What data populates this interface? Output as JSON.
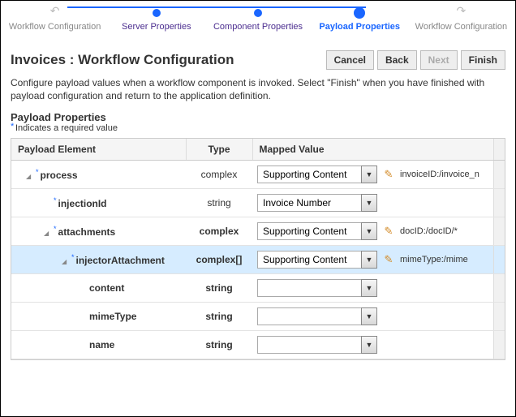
{
  "stepper": {
    "steps": [
      {
        "label": "Workflow Configuration",
        "kind": "arrow-prev"
      },
      {
        "label": "Server Properties",
        "kind": "linked"
      },
      {
        "label": "Component Properties",
        "kind": "linked"
      },
      {
        "label": "Payload Properties",
        "kind": "active"
      },
      {
        "label": "Workflow Configuration",
        "kind": "arrow-next"
      }
    ]
  },
  "page": {
    "title": "Invoices : Workflow Configuration",
    "description": "Configure payload values when a workflow component is invoked. Select \"Finish\" when you have finished with payload configuration and return to the application definition."
  },
  "buttons": {
    "cancel": "Cancel",
    "back": "Back",
    "next": "Next",
    "finish": "Finish"
  },
  "section": {
    "title": "Payload Properties",
    "required_note": "Indicates a required value"
  },
  "table": {
    "headers": {
      "element": "Payload Element",
      "type": "Type",
      "mapped": "Mapped Value"
    },
    "rows": [
      {
        "indent": 0,
        "toggle": "▿",
        "required": true,
        "name": "process",
        "type": "complex",
        "type_bold": false,
        "value": "Supporting Content",
        "hasCombo": true,
        "hasEdit": true,
        "extra": "invoiceID:/invoice_n",
        "selected": false
      },
      {
        "indent": 1,
        "toggle": "",
        "required": true,
        "name": "injectionId",
        "type": "string",
        "type_bold": false,
        "value": "Invoice Number",
        "hasCombo": true,
        "hasEdit": false,
        "extra": "",
        "selected": false
      },
      {
        "indent": 1,
        "toggle": "▿",
        "required": true,
        "name": "attachments",
        "type": "complex",
        "type_bold": true,
        "value": "Supporting Content",
        "hasCombo": true,
        "hasEdit": true,
        "extra": "docID:/docID/*",
        "selected": false
      },
      {
        "indent": 2,
        "toggle": "▿",
        "required": true,
        "name": "injectorAttachment",
        "type": "complex[]",
        "type_bold": true,
        "value": "Supporting Content",
        "hasCombo": true,
        "hasEdit": true,
        "extra": "mimeType:/mime",
        "selected": true
      },
      {
        "indent": 3,
        "toggle": "",
        "required": false,
        "name": "content",
        "type": "string",
        "type_bold": true,
        "value": "",
        "hasCombo": true,
        "hasEdit": false,
        "extra": "",
        "selected": false
      },
      {
        "indent": 3,
        "toggle": "",
        "required": false,
        "name": "mimeType",
        "type": "string",
        "type_bold": true,
        "value": "",
        "hasCombo": true,
        "hasEdit": false,
        "extra": "",
        "selected": false
      },
      {
        "indent": 3,
        "toggle": "",
        "required": false,
        "name": "name",
        "type": "string",
        "type_bold": true,
        "value": "",
        "hasCombo": true,
        "hasEdit": false,
        "extra": "",
        "selected": false
      }
    ]
  }
}
